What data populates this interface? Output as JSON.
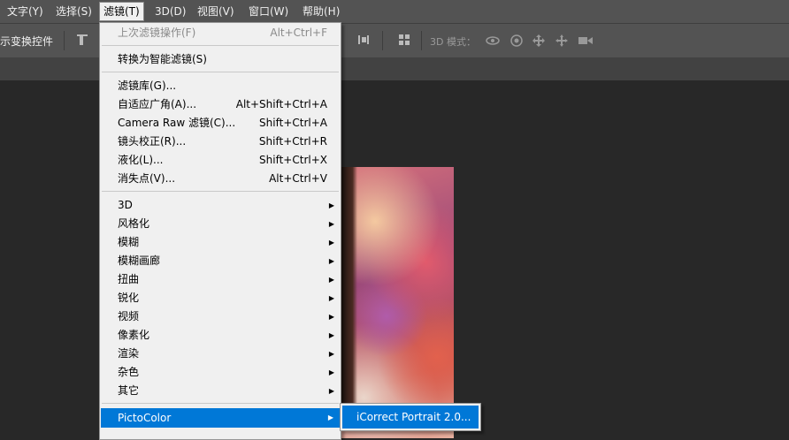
{
  "menubar": {
    "items": [
      {
        "label": "文字(Y)"
      },
      {
        "label": "选择(S)"
      },
      {
        "label": "滤镜(T)",
        "active": true
      },
      {
        "label": "3D(D)"
      },
      {
        "label": "视图(V)"
      },
      {
        "label": "窗口(W)"
      },
      {
        "label": "帮助(H)"
      }
    ]
  },
  "options_bar": {
    "show_transform_label": "示变换控件",
    "mode_3d_label": "3D 模式："
  },
  "filter_menu": {
    "last_filter": {
      "label": "上次滤镜操作(F)",
      "shortcut": "Alt+Ctrl+F"
    },
    "convert_smart": {
      "label": "转换为智能滤镜(S)"
    },
    "gallery": {
      "label": "滤镜库(G)..."
    },
    "adaptive_wide": {
      "label": "自适应广角(A)...",
      "shortcut": "Alt+Shift+Ctrl+A"
    },
    "camera_raw": {
      "label": "Camera Raw 滤镜(C)...",
      "shortcut": "Shift+Ctrl+A"
    },
    "lens_correction": {
      "label": "镜头校正(R)...",
      "shortcut": "Shift+Ctrl+R"
    },
    "liquify": {
      "label": "液化(L)...",
      "shortcut": "Shift+Ctrl+X"
    },
    "vanishing_point": {
      "label": "消失点(V)...",
      "shortcut": "Alt+Ctrl+V"
    },
    "submenus": [
      "3D",
      "风格化",
      "模糊",
      "模糊画廊",
      "扭曲",
      "锐化",
      "视频",
      "像素化",
      "渲染",
      "杂色",
      "其它"
    ],
    "pictocolor": {
      "label": "PictoColor"
    }
  },
  "submenu": {
    "item": "iCorrect Portrait 2.0..."
  }
}
